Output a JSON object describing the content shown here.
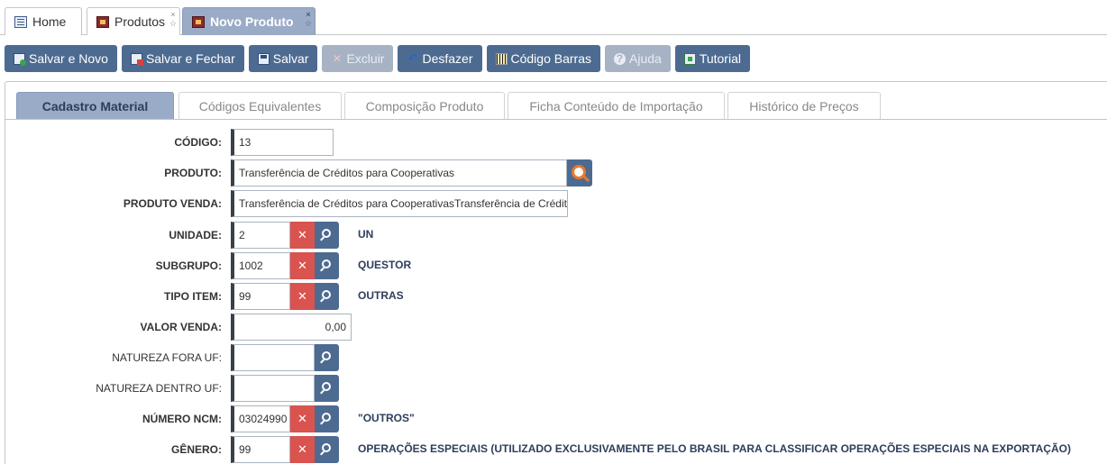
{
  "window_tabs": [
    {
      "label": "Home",
      "icon": "home-icon",
      "active": false
    },
    {
      "label": "Produtos",
      "icon": "box-icon",
      "active": false
    },
    {
      "label": "Novo Produto",
      "icon": "box-icon",
      "active": true
    }
  ],
  "tab_controls": {
    "close": "×",
    "pin": "☆"
  },
  "toolbar": {
    "salvar_novo": "Salvar e Novo",
    "salvar_fechar": "Salvar e Fechar",
    "salvar": "Salvar",
    "excluir": "Excluir",
    "desfazer": "Desfazer",
    "codigo_barras": "Código Barras",
    "ajuda": "Ajuda",
    "tutorial": "Tutorial",
    "excluir_glyph": "✕",
    "desfazer_glyph": "↶",
    "ajuda_glyph": "?"
  },
  "sub_tabs": [
    "Cadastro Material",
    "Códigos Equivalentes",
    "Composição Produto",
    "Ficha Conteúdo de Importação",
    "Histórico de Preços"
  ],
  "clear_glyph": "✕",
  "form": {
    "codigo": {
      "label": "CÓDIGO:",
      "value": "13"
    },
    "produto": {
      "label": "PRODUTO:",
      "value": "Transferência de Créditos para Cooperativas"
    },
    "produto_venda": {
      "label": "PRODUTO VENDA:",
      "value": "Transferência de Créditos para CooperativasTransferência de Crédito"
    },
    "unidade": {
      "label": "UNIDADE:",
      "value": "2",
      "desc": "UN"
    },
    "subgrupo": {
      "label": "SUBGRUPO:",
      "value": "1002",
      "desc": "QUESTOR"
    },
    "tipo_item": {
      "label": "TIPO ITEM:",
      "value": "99",
      "desc": "OUTRAS"
    },
    "valor_venda": {
      "label": "VALOR VENDA:",
      "value": "0,00"
    },
    "natureza_fora_uf": {
      "label": "NATUREZA FORA UF:",
      "value": ""
    },
    "natureza_dentro_uf": {
      "label": "NATUREZA DENTRO UF:",
      "value": ""
    },
    "numero_ncm": {
      "label": "NÚMERO NCM:",
      "value": "03024990",
      "desc": "\"OUTROS\""
    },
    "genero": {
      "label": "GÊNERO:",
      "value": "99",
      "desc": "OPERAÇÕES ESPECIAIS (UTILIZADO EXCLUSIVAMENTE PELO BRASIL PARA CLASSIFICAR OPERAÇÕES ESPECIAIS NA EXPORTAÇÃO)"
    }
  },
  "colors": {
    "primary": "#4d6b91",
    "active_tab": "#9aabc7",
    "clear": "#d9534f",
    "disabled": "#a7b3c5"
  }
}
